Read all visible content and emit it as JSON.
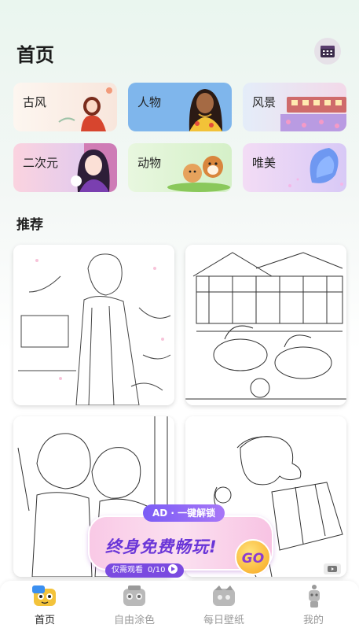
{
  "header": {
    "title": "首页"
  },
  "categories": [
    {
      "label": "古风",
      "bg": "#fbf1ea"
    },
    {
      "label": "人物",
      "bg": "#7fb6ec"
    },
    {
      "label": "风景",
      "bg": "#dfe8f6"
    },
    {
      "label": "二次元",
      "bg": "#f8cfdc"
    },
    {
      "label": "动物",
      "bg": "#e2f5d6"
    },
    {
      "label": "唯美",
      "bg": "#efd8f6"
    }
  ],
  "recommend": {
    "title": "推荐"
  },
  "promo": {
    "tag": "AD · 一键解锁",
    "headline": "终身免费畅玩!",
    "sub_label": "仅需观看",
    "sub_count": "0/10",
    "go": "GO"
  },
  "tabs": [
    {
      "label": "首页",
      "active": true
    },
    {
      "label": "自由涂色",
      "active": false
    },
    {
      "label": "每日壁纸",
      "active": false
    },
    {
      "label": "我的",
      "active": false
    }
  ]
}
